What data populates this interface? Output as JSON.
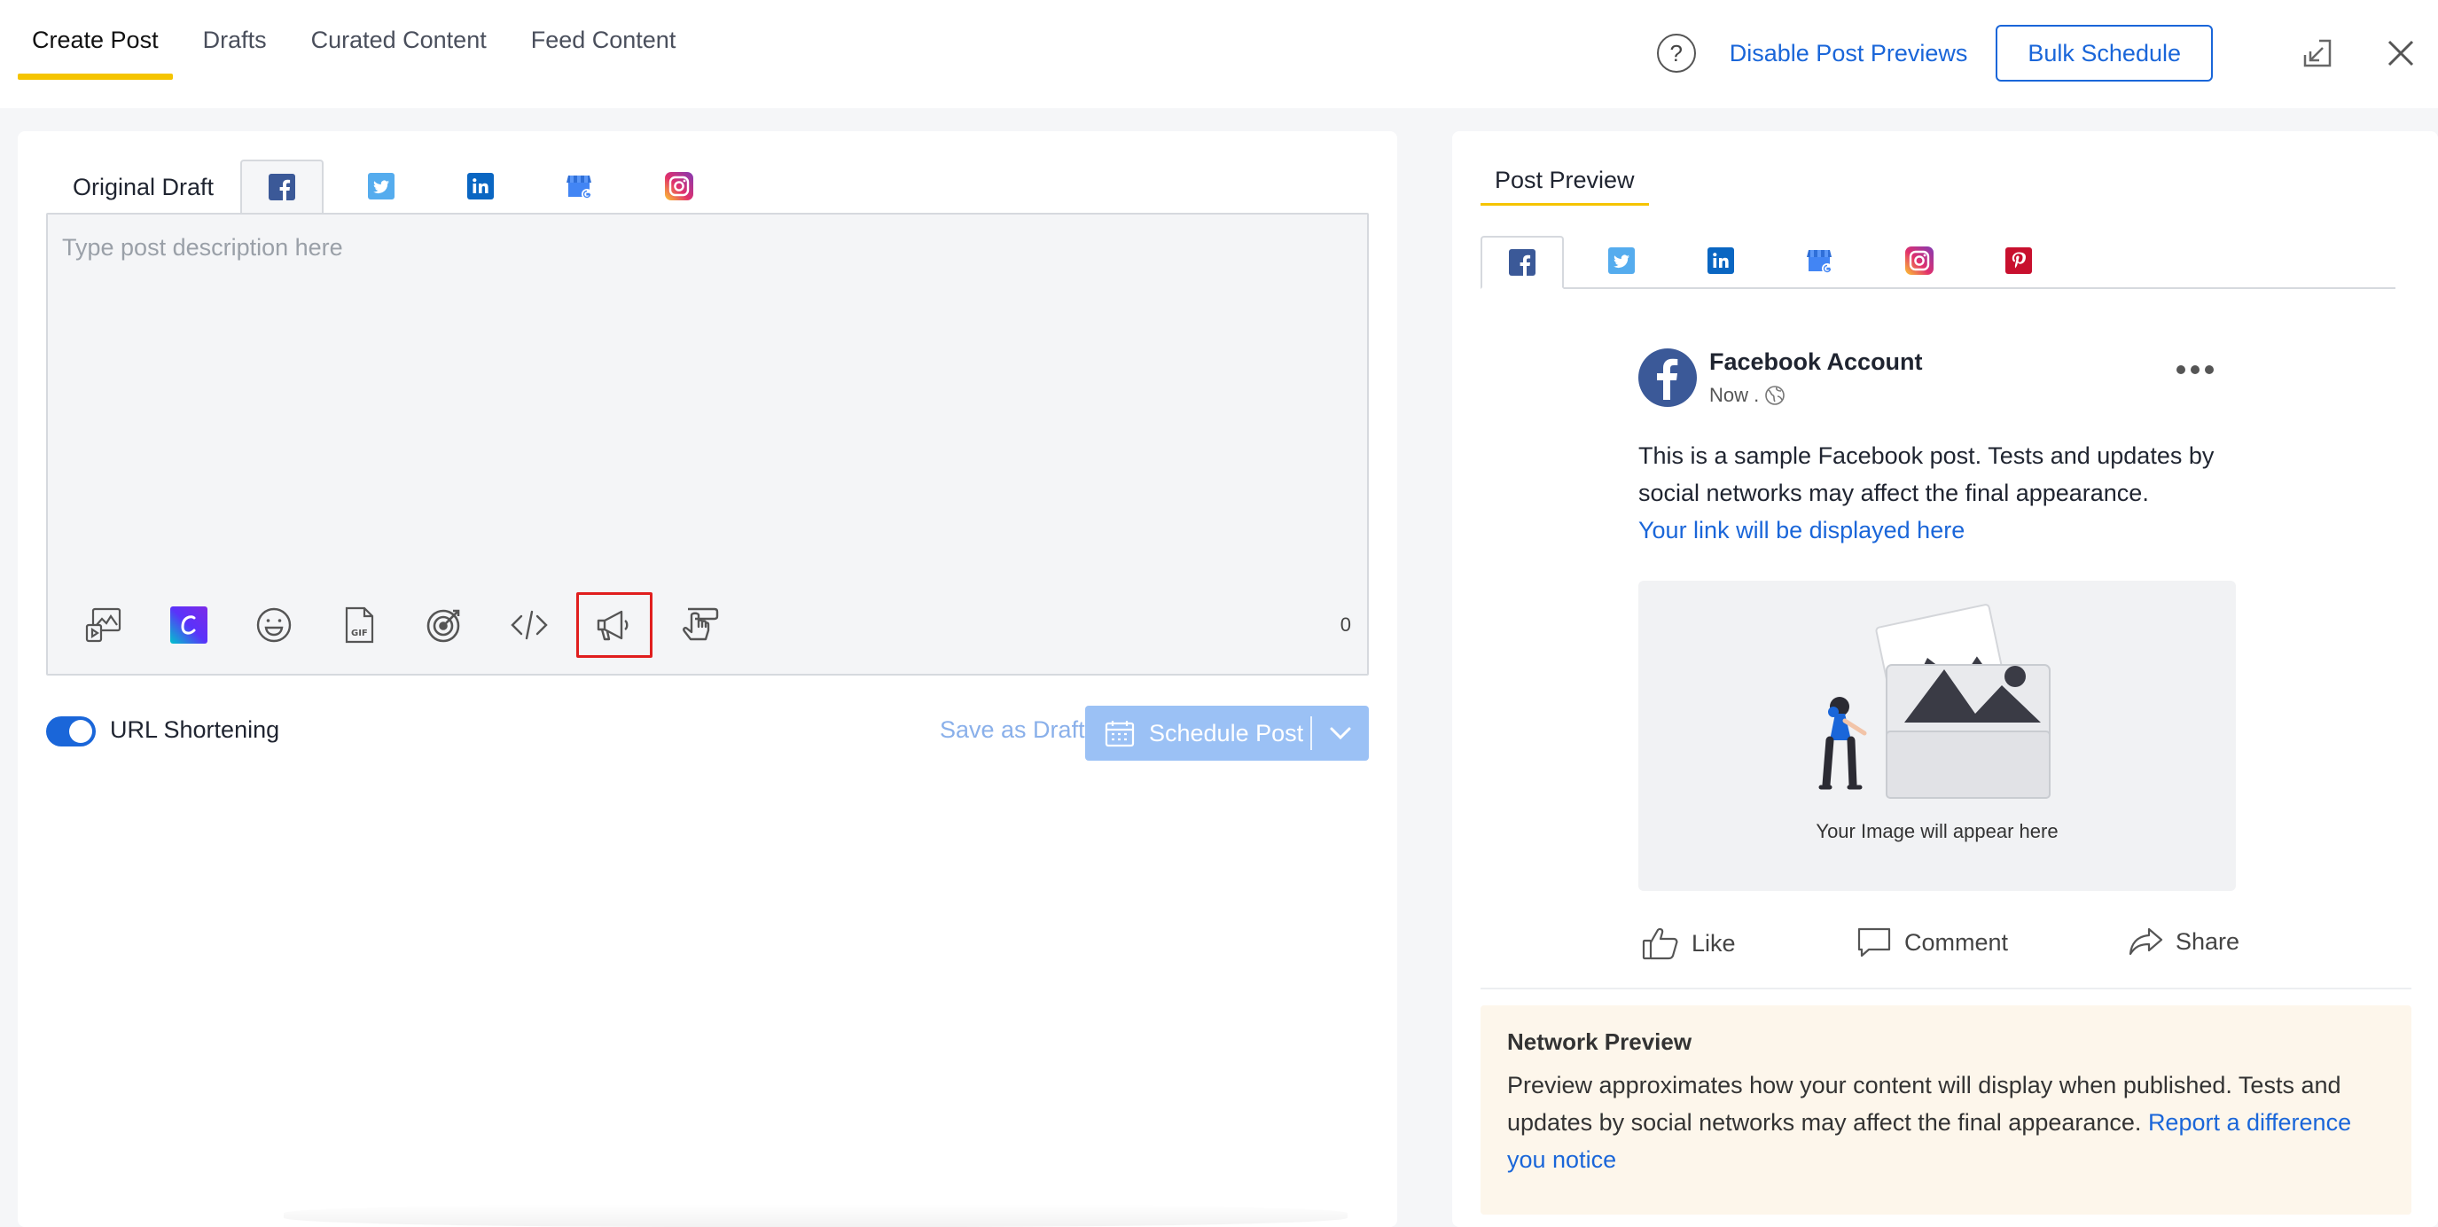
{
  "nav": {
    "tabs": [
      "Create Post",
      "Drafts",
      "Curated Content",
      "Feed Content"
    ],
    "active_tab": "Create Post"
  },
  "header": {
    "help_icon": "question-circle-icon",
    "disable_previews": "Disable Post Previews",
    "bulk_schedule": "Bulk Schedule"
  },
  "editor": {
    "original_draft": "Original Draft",
    "networks": [
      "facebook",
      "twitter",
      "linkedin",
      "google-business",
      "instagram"
    ],
    "placeholder": "Type post description here",
    "char_count": "0",
    "tools": [
      "media-icon",
      "canva-icon",
      "emoji-icon",
      "gif-icon",
      "target-icon",
      "code-icon",
      "megaphone-icon",
      "hand-pointer-icon"
    ]
  },
  "actions": {
    "url_shortening": "URL Shortening",
    "save_draft": "Save as Draft",
    "schedule": "Schedule Post"
  },
  "preview": {
    "title": "Post Preview",
    "networks": [
      "facebook",
      "twitter",
      "linkedin",
      "google-business",
      "instagram",
      "pinterest"
    ],
    "account": "Facebook Account",
    "time": "Now .",
    "text": "This is a sample Facebook post. Tests and updates by social networks may affect the final appearance.",
    "link": "Your link will be displayed here",
    "image_caption": "Your Image will appear here",
    "like": "Like",
    "comment": "Comment",
    "share": "Share"
  },
  "notice": {
    "title": "Network Preview",
    "body": "Preview approximates how your content will display when published. Tests and updates by social networks may affect the final appearance. ",
    "link": "Report a difference you notice"
  },
  "colors": {
    "accent": "#1a66d9",
    "active_tab_underline": "#f5c400",
    "highlight_box": "#e01e1e",
    "schedule_disabled": "#9bc1f5"
  }
}
